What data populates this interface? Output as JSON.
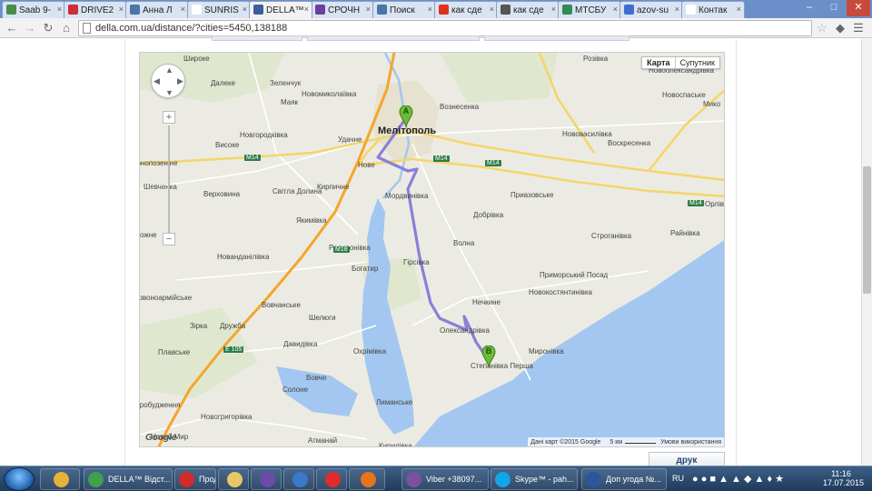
{
  "tabs": [
    {
      "title": "Saab 9-",
      "icon": "chrome-favicon",
      "color": "#4a8c4a"
    },
    {
      "title": "DRIVE2",
      "icon": "drive2-favicon",
      "color": "#cc2d3b"
    },
    {
      "title": "Анна Л",
      "icon": "vk-favicon",
      "color": "#4a76a8"
    },
    {
      "title": "SUNRIS",
      "icon": "document-favicon",
      "color": "#ffffff"
    },
    {
      "title": "DELLA™",
      "icon": "della-favicon",
      "color": "#3a5f9c"
    },
    {
      "title": "СРОЧН",
      "icon": "olx-favicon",
      "color": "#6a3fa0"
    },
    {
      "title": "Поиск",
      "icon": "vk-favicon",
      "color": "#4a76a8"
    },
    {
      "title": "как сде",
      "icon": "yandex-favicon",
      "color": "#e0301e"
    },
    {
      "title": "как сде",
      "icon": "youtube-favicon",
      "color": "#555555"
    },
    {
      "title": "МТСБУ",
      "icon": "mtsbu-favicon",
      "color": "#2f8c5a"
    },
    {
      "title": "azov-su",
      "icon": "azov-favicon",
      "color": "#3c6fcf"
    },
    {
      "title": "Контак",
      "icon": "document-favicon",
      "color": "#ffffff"
    }
  ],
  "active_tab": 4,
  "window": {
    "minimize": "–",
    "maximize": "□",
    "close": "✕"
  },
  "address": {
    "url": "della.com.ua/distance/?cities=5450,138188"
  },
  "map": {
    "maptype_map": "Карта",
    "maptype_satellite": "Супутник",
    "attribution": "Дані карт ©2015 Google",
    "scale": "5 км",
    "terms": "Умови використання",
    "marker_a": "A",
    "marker_b": "B",
    "route_color": "#8b7fd8",
    "labels": [
      {
        "t": "Широке",
        "big": false
      },
      {
        "t": "Далеке",
        "big": false
      },
      {
        "t": "Зеленчук",
        "big": false
      },
      {
        "t": "Новомиколаївка",
        "big": false
      },
      {
        "t": "Маяк",
        "big": false
      },
      {
        "t": "Розівка",
        "big": false
      },
      {
        "t": "Вознесенка",
        "big": false
      },
      {
        "t": "Новоолександрівка",
        "big": false
      },
      {
        "t": "Мелітополь",
        "big": true
      },
      {
        "t": "Новгородківка",
        "big": false
      },
      {
        "t": "Удачне",
        "big": false
      },
      {
        "t": "Новоспаське",
        "big": false
      },
      {
        "t": "Мико",
        "big": false
      },
      {
        "t": "Високе",
        "big": false
      },
      {
        "t": "Нововасилівка",
        "big": false
      },
      {
        "t": "Воскресенка",
        "big": false
      },
      {
        "t": "орнопозеніне",
        "big": false
      },
      {
        "t": "Нове",
        "big": false
      },
      {
        "t": "Шевченка",
        "big": false
      },
      {
        "t": "Верховина",
        "big": false
      },
      {
        "t": "Світла Долина",
        "big": false
      },
      {
        "t": "Кирпичне",
        "big": false
      },
      {
        "t": "Мордвинівка",
        "big": false
      },
      {
        "t": "Приазовське",
        "big": false
      },
      {
        "t": "Орлівк",
        "big": false
      },
      {
        "t": "Якимівка",
        "big": false
      },
      {
        "t": "Добрівка",
        "big": false
      },
      {
        "t": "ожне",
        "big": false
      },
      {
        "t": "Радивонівка",
        "big": false
      },
      {
        "t": "Волна",
        "big": false
      },
      {
        "t": "Строганівка",
        "big": false
      },
      {
        "t": "Райнівка",
        "big": false
      },
      {
        "t": "Нованданілівка",
        "big": false
      },
      {
        "t": "Гірсівка",
        "big": false
      },
      {
        "t": "Богатир",
        "big": false
      },
      {
        "t": "Приморський Посад",
        "big": false
      },
      {
        "t": "ервоноармійське",
        "big": false
      },
      {
        "t": "Новокостянтинівка",
        "big": false
      },
      {
        "t": "Вовчанське",
        "big": false
      },
      {
        "t": "Нечкине",
        "big": false
      },
      {
        "t": "Шелюги",
        "big": false
      },
      {
        "t": "Зірка",
        "big": false
      },
      {
        "t": "Дружба",
        "big": false
      },
      {
        "t": "Олександрівка",
        "big": false
      },
      {
        "t": "Плавське",
        "big": false
      },
      {
        "t": "Давидівка",
        "big": false
      },
      {
        "t": "Охрімівка",
        "big": false
      },
      {
        "t": "Миронівка",
        "big": false
      },
      {
        "t": "Степанівка Перша",
        "big": false
      },
      {
        "t": "Вовче",
        "big": false
      },
      {
        "t": "Солоне",
        "big": false
      },
      {
        "t": "Пробудження",
        "big": false
      },
      {
        "t": "Лиманське",
        "big": false
      },
      {
        "t": "Новогригорівка",
        "big": false
      },
      {
        "t": "Новий Мир",
        "big": false
      },
      {
        "t": "Атманай",
        "big": false
      },
      {
        "t": "Кирилівка",
        "big": false
      }
    ],
    "roads": [
      {
        "t": "M14"
      },
      {
        "t": "M14"
      },
      {
        "t": "M14"
      },
      {
        "t": "M14"
      },
      {
        "t": "M18"
      },
      {
        "t": "E 105"
      }
    ]
  },
  "print_button": "друк",
  "taskbar": {
    "items": [
      {
        "label": "",
        "icon": "chrome-icon",
        "color": "#e6b23a"
      },
      {
        "label": "DELLA™ Відст...",
        "icon": "chrome-icon",
        "color": "#3ea14c"
      },
      {
        "label": "Продажа ВА...",
        "icon": "opera-icon",
        "color": "#d12b2b"
      },
      {
        "label": "",
        "icon": "explorer-folder-icon",
        "color": "#e9c766"
      },
      {
        "label": "",
        "icon": "visual-studio-icon",
        "color": "#6b4aa8"
      },
      {
        "label": "",
        "icon": "media-player-icon",
        "color": "#3b78c8"
      },
      {
        "label": "",
        "icon": "yandex-icon",
        "color": "#e02b2b"
      },
      {
        "label": "",
        "icon": "firefox-icon",
        "color": "#e8751c"
      },
      {
        "label": "Viber +38097...",
        "icon": "viber-icon",
        "color": "#7b519d"
      },
      {
        "label": "Skype™ - pah...",
        "icon": "skype-icon",
        "color": "#12a5e8"
      },
      {
        "label": "Доп угода №...",
        "icon": "word-icon",
        "color": "#2b579a"
      }
    ],
    "language": "RU",
    "time": "11:16",
    "date": "17.07.2015"
  }
}
